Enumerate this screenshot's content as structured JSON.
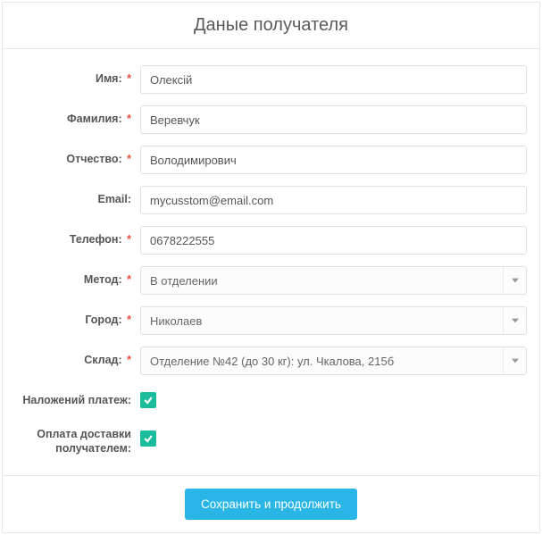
{
  "header": {
    "title": "Даные получателя"
  },
  "form": {
    "first_name": {
      "label": "Имя:",
      "value": "Олексій",
      "required": true
    },
    "last_name": {
      "label": "Фамилия:",
      "value": "Веревчук",
      "required": true
    },
    "patronymic": {
      "label": "Отчество:",
      "value": "Володимирович",
      "required": true
    },
    "email": {
      "label": "Email:",
      "value": "mycusstom@email.com",
      "required": false
    },
    "phone": {
      "label": "Телефон:",
      "value": "0678222555",
      "required": true
    },
    "method": {
      "label": "Метод:",
      "value": "В отделении",
      "required": true
    },
    "city": {
      "label": "Город:",
      "value": "Николаев",
      "required": true
    },
    "warehouse": {
      "label": "Склад:",
      "value": "Отделение №42 (до 30 кг): ул. Чкалова, 215б",
      "required": true
    },
    "cod": {
      "label": "Наложений платеж:",
      "checked": true
    },
    "pay_by_recipient": {
      "label": "Оплата доставки получателем:",
      "checked": true
    }
  },
  "actions": {
    "submit": "Сохранить и продолжить"
  },
  "required_marker": "*"
}
